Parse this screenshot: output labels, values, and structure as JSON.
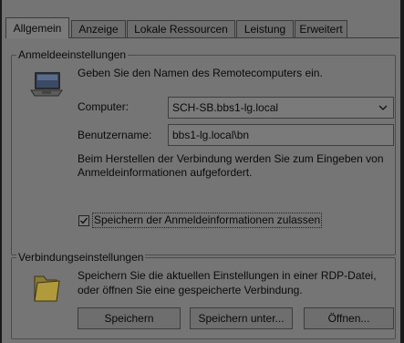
{
  "tabs": [
    "Allgemein",
    "Anzeige",
    "Lokale Ressourcen",
    "Leistung",
    "Erweitert"
  ],
  "logon": {
    "legend": "Anmeldeeinstellungen",
    "intro": "Geben Sie den Namen des Remotecomputers ein.",
    "computer_label": "Computer:",
    "computer_value": "SCH-SB.bbs1-lg.local",
    "user_label": "Benutzername:",
    "user_value": "bbs1-lg.local\\bn",
    "note_line1": "Beim Herstellen der Verbindung werden Sie zum Eingeben von",
    "note_line2": "Anmeldeinformationen aufgefordert.",
    "save_creds_label": "Speichern der Anmeldeinformationen zulassen",
    "save_creds_checked": true
  },
  "connection": {
    "legend": "Verbindungseinstellungen",
    "desc_line1": "Speichern Sie die aktuellen Einstellungen in einer RDP-Datei,",
    "desc_line2": "oder öffnen Sie eine gespeicherte Verbindung.",
    "save_btn": "Speichern",
    "save_as_btn": "Speichern unter...",
    "open_btn": "Öffnen..."
  },
  "icons": {
    "computer": "monitor-icon",
    "folder": "folder-icon",
    "dropdown": "chevron-down-icon"
  }
}
